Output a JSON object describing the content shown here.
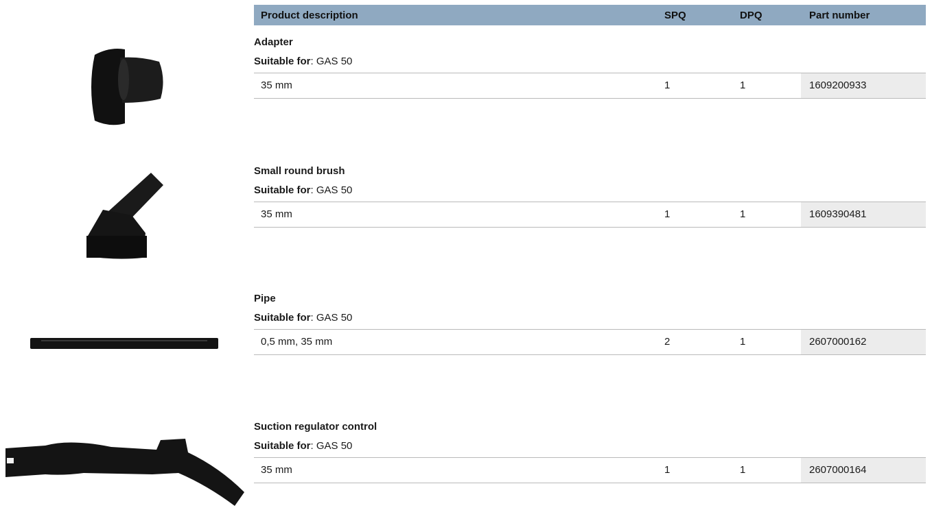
{
  "table_header": {
    "product_description": "Product description",
    "spq": "SPQ",
    "dpq": "DPQ",
    "part_number": "Part number"
  },
  "products": [
    {
      "name": "Adapter",
      "suitable_label": "Suitable for",
      "suitable_value": ": GAS 50",
      "desc": "35 mm",
      "spq": "1",
      "dpq": "1",
      "part_number": "1609200933"
    },
    {
      "name": "Small round brush",
      "suitable_label": "Suitable for",
      "suitable_value": ": GAS 50",
      "desc": "35 mm",
      "spq": "1",
      "dpq": "1",
      "part_number": "1609390481"
    },
    {
      "name": "Pipe",
      "suitable_label": "Suitable for",
      "suitable_value": ": GAS 50",
      "desc": "0,5 mm, 35 mm",
      "spq": "2",
      "dpq": "1",
      "part_number": "2607000162"
    },
    {
      "name": "Suction regulator control",
      "suitable_label": "Suitable for",
      "suitable_value": ": GAS 50",
      "desc": "35 mm",
      "spq": "1",
      "dpq": "1",
      "part_number": "2607000164"
    }
  ],
  "colors": {
    "header_bg": "#8fa9c1",
    "part_number_cell_bg": "#ececec",
    "product_color": "#141414"
  }
}
